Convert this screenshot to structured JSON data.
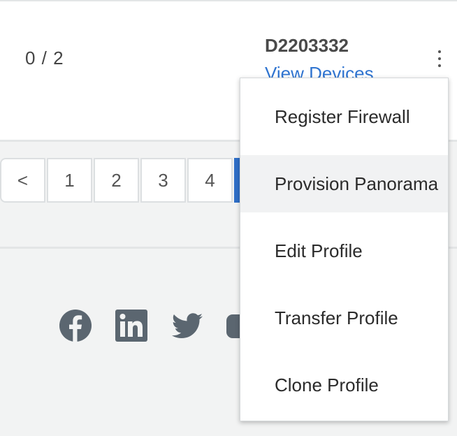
{
  "row": {
    "count": "0 / 2",
    "device_id": "D2203332",
    "view_devices_label": "View Devices",
    "menu_icon": "kebab-vertical-icon"
  },
  "pagination": {
    "prev_label": "<",
    "pages": [
      "1",
      "2",
      "3",
      "4"
    ],
    "active_page_visible": true
  },
  "footer": {
    "social_icons": [
      "facebook-icon",
      "linkedin-icon",
      "twitter-icon",
      "youtube-icon"
    ]
  },
  "menu": {
    "items": [
      "Register Firewall",
      "Provision Panorama",
      "Edit Profile",
      "Transfer Profile",
      "Clone Profile"
    ],
    "highlighted_item": "Provision Panorama"
  },
  "colors": {
    "link": "#2f74d0",
    "active_page": "#2f6fc7",
    "icon_gray": "#5b6670",
    "background": "#f2f3f3"
  }
}
